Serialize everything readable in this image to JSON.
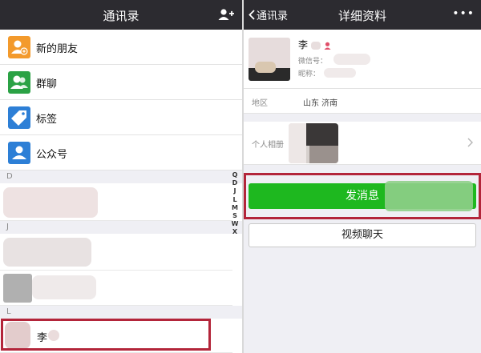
{
  "left_screen": {
    "title": "通讯录",
    "icons": {
      "add_contact": "add-contact-icon"
    },
    "menu": [
      {
        "label": "新的朋友",
        "icon": "new-friend-icon",
        "color": "#f39a2c"
      },
      {
        "label": "群聊",
        "icon": "group-chat-icon",
        "color": "#2ba245"
      },
      {
        "label": "标签",
        "icon": "tag-icon",
        "color": "#2d7fd6"
      },
      {
        "label": "公众号",
        "icon": "official-account-icon",
        "color": "#2d7fd6"
      }
    ],
    "sections": [
      "D",
      "J",
      "L"
    ],
    "highlighted_contact": {
      "name": "李"
    },
    "index_letters": [
      "Q",
      "D",
      "J",
      "L",
      "M",
      "S",
      "W",
      "X"
    ]
  },
  "right_screen": {
    "back_label": "通讯录",
    "title": "详细资料",
    "more": "•••",
    "profile": {
      "name": "李",
      "wechat_id_label": "微信号：",
      "nickname_label": "昵称："
    },
    "region": {
      "label": "地区",
      "value": "山东 济南"
    },
    "album": {
      "label": "个人相册"
    },
    "send_button": "发消息",
    "video_button": "视频聊天"
  },
  "colors": {
    "nav_bg": "#2c2b30",
    "send_green": "#1eb81f",
    "highlight": "#b3253a"
  }
}
